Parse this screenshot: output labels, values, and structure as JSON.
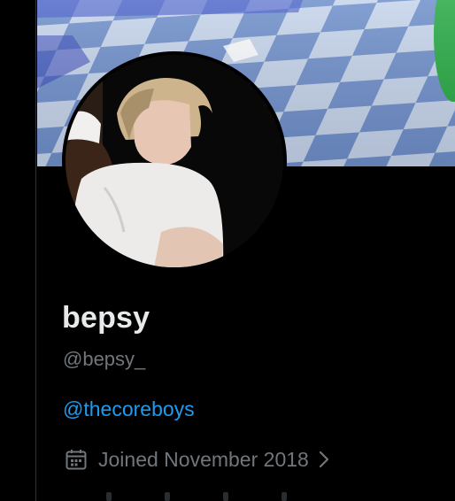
{
  "profile": {
    "display_name": "bepsy",
    "handle": "@bepsy_",
    "bio_link": "@thecoreboys",
    "joined": "Joined November 2018"
  },
  "icons": {
    "joined": "calendar-icon",
    "joined_chevron": "chevron-right-icon"
  },
  "colors": {
    "background": "#000000",
    "name": "#e7e9ea",
    "secondary": "#71767b",
    "link": "#1d9bf0"
  }
}
